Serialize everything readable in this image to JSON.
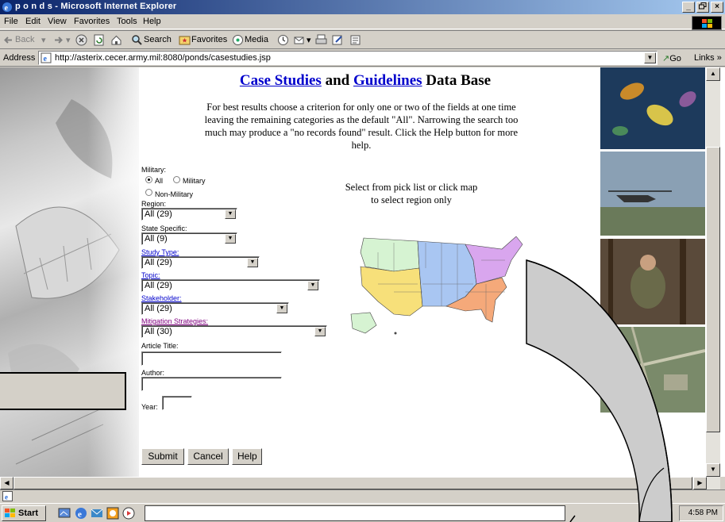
{
  "window": {
    "title": "p o n d s - Microsoft Internet Explorer",
    "controls": [
      "_",
      "×"
    ]
  },
  "menu": [
    "File",
    "Edit",
    "View",
    "Favorites",
    "Tools",
    "Help"
  ],
  "toolbar": {
    "back": "Back",
    "search": "Search",
    "favorites": "Favorites",
    "media": "Media"
  },
  "address": {
    "label": "Address",
    "url": "http://asterix.cecer.army.mil:8080/ponds/casestudies.jsp",
    "go": "Go",
    "links": "Links »"
  },
  "page": {
    "title_link1": "Case Studies",
    "title_and": "and",
    "title_link2": "Guidelines",
    "title_rest": "Data Base",
    "intro": "For best results choose a criterion for only one or two of the fields at one time leaving the remaining categories as the default \"All\". Narrowing the search too much may produce a \"no records found\" result. Click the Help button for more help.",
    "map_note_1": "Select from pick list or click map",
    "map_note_2": "to select region only",
    "map_colors": {
      "west": "#f7e07a",
      "northwest": "#d6f3d2",
      "central": "#a9c6f2",
      "southeast": "#f5a97a",
      "northeast": "#d9a6ee"
    }
  },
  "form": {
    "military_label": "Military:",
    "radio_all": "All",
    "radio_military": "Military",
    "radio_nonmilitary": "Non-Military",
    "region_label": "Region:",
    "region_value": "All (29)",
    "state_label": "State Specific:",
    "state_value": "All (9)",
    "study_label": "Study Type",
    "study_value": "All (29)",
    "topic_label": "Topic",
    "topic_value": "All (29)",
    "stakeholder_label": "Stakeholder",
    "stakeholder_value": "All (29)",
    "mitigation_label": "Mitigation Strategies",
    "mitigation_value": "All (30)",
    "article_label": "Article Title:",
    "author_label": "Author:",
    "year_label": "Year:",
    "submit": "Submit",
    "cancel": "Cancel",
    "help": "Help"
  },
  "taskbar": {
    "start": "Start",
    "clock": "4:58 PM"
  }
}
